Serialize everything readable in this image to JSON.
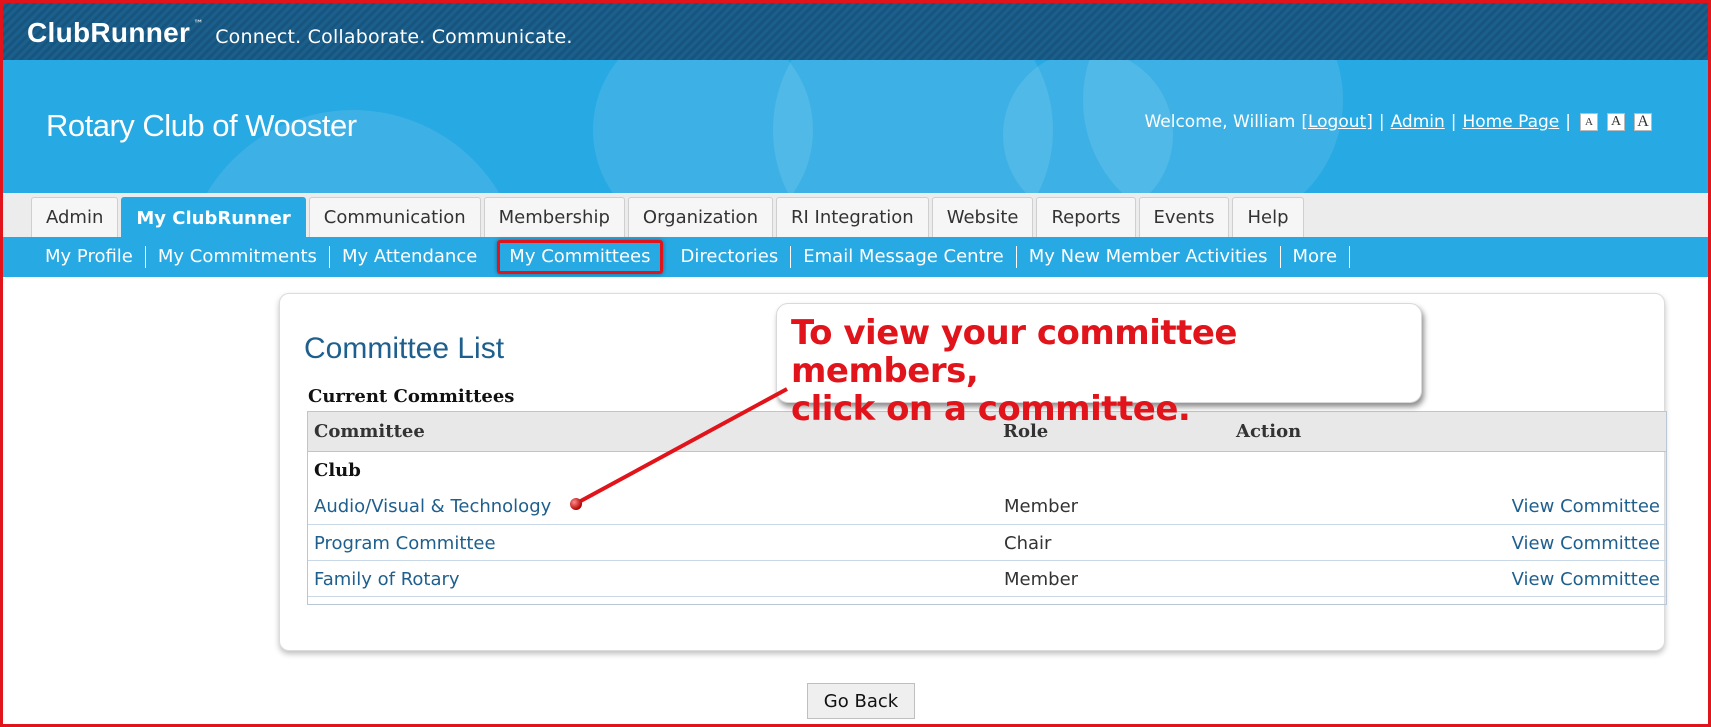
{
  "brand": {
    "logo": "ClubRunner",
    "tm": "™",
    "tagline": "Connect. Collaborate. Communicate."
  },
  "header": {
    "club_name": "Rotary Club of Wooster",
    "welcome": "Welcome, William",
    "logout": "Logout",
    "admin": "Admin",
    "home_page": "Home Page",
    "sep": "|",
    "font_sizes": [
      "A",
      "A",
      "A"
    ]
  },
  "tabs": [
    {
      "label": "Admin",
      "active": false
    },
    {
      "label": "My ClubRunner",
      "active": true
    },
    {
      "label": "Communication",
      "active": false
    },
    {
      "label": "Membership",
      "active": false
    },
    {
      "label": "Organization",
      "active": false
    },
    {
      "label": "RI Integration",
      "active": false
    },
    {
      "label": "Website",
      "active": false
    },
    {
      "label": "Reports",
      "active": false
    },
    {
      "label": "Events",
      "active": false
    },
    {
      "label": "Help",
      "active": false
    }
  ],
  "subnav": [
    "My Profile",
    "My Commitments",
    "My Attendance",
    "My Committees",
    "Directories",
    "Email Message Centre",
    "My New Member Activities",
    "More"
  ],
  "page": {
    "title": "Committee List",
    "subtitle": "Current Committees",
    "columns": {
      "committee": "Committee",
      "role": "Role",
      "action": "Action"
    },
    "group": "Club",
    "rows": [
      {
        "name": "Audio/Visual & Technology",
        "role": "Member",
        "action": "View Committee"
      },
      {
        "name": "Program Committee",
        "role": "Chair",
        "action": "View Committee"
      },
      {
        "name": "Family of Rotary",
        "role": "Member",
        "action": "View Committee"
      }
    ],
    "go_back": "Go Back"
  },
  "callout": {
    "line1": "To view your committee members,",
    "line2": "click on a committee.",
    "color": "#e0141a"
  },
  "colors": {
    "header_blue": "#27a9e3",
    "brand_bar": "#1b5f8c",
    "link": "#1e5f8d",
    "annotation_red": "#e0141a"
  }
}
